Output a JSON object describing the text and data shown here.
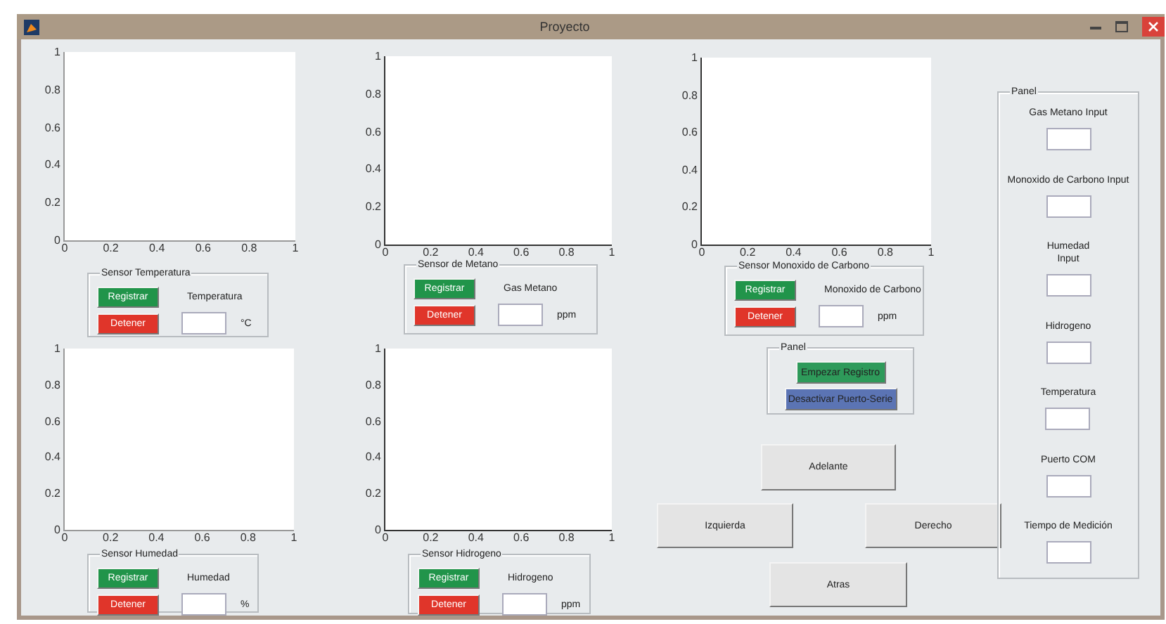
{
  "window": {
    "title": "Proyecto"
  },
  "axes": [
    {
      "y_tick_labels": [
        "1",
        "0.8",
        "0.6",
        "0.4",
        "0.2",
        "0"
      ],
      "x_tick_labels": [
        "0",
        "0.2",
        "0.4",
        "0.6",
        "0.8",
        "1"
      ]
    },
    {
      "y_tick_labels": [
        "1",
        "0.8",
        "0.6",
        "0.4",
        "0.2",
        "0"
      ],
      "x_tick_labels": [
        "0",
        "0.2",
        "0.4",
        "0.6",
        "0.8",
        "1"
      ]
    },
    {
      "y_tick_labels": [
        "1",
        "0.8",
        "0.6",
        "0.4",
        "0.2",
        "0"
      ],
      "x_tick_labels": [
        "0",
        "0.2",
        "0.4",
        "0.6",
        "0.8",
        "1"
      ]
    },
    {
      "y_tick_labels": [
        "1",
        "0.8",
        "0.6",
        "0.4",
        "0.2",
        "0"
      ],
      "x_tick_labels": [
        "0",
        "0.2",
        "0.4",
        "0.6",
        "0.8",
        "1"
      ]
    },
    {
      "y_tick_labels": [
        "1",
        "0.8",
        "0.6",
        "0.4",
        "0.2",
        "0"
      ],
      "x_tick_labels": [
        "0",
        "0.2",
        "0.4",
        "0.6",
        "0.8",
        "1"
      ]
    }
  ],
  "sensor_panels": [
    {
      "title": "Sensor Temperatura",
      "register_button": "Registrar",
      "stop_button": "Detener",
      "label": "Temperatura",
      "unit": "°C"
    },
    {
      "title": "Sensor de Metano",
      "register_button": "Registrar",
      "stop_button": "Detener",
      "label": "Gas Metano",
      "unit": "ppm"
    },
    {
      "title": "Sensor Monoxido de Carbono",
      "register_button": "Registrar",
      "stop_button": "Detener",
      "label": "Monoxido de Carbono",
      "unit": "ppm"
    },
    {
      "title": "Sensor Humedad",
      "register_button": "Registrar",
      "stop_button": "Detener",
      "label": "Humedad",
      "unit": "%"
    },
    {
      "title": "Sensor Hidrogeno",
      "register_button": "Registrar",
      "stop_button": "Detener",
      "label": "Hidrogeno",
      "unit": "ppm"
    }
  ],
  "control_panel": {
    "title": "Panel",
    "buttons": [
      {
        "label": "Empezar Registro",
        "color": "#2e9a5a"
      },
      {
        "label": "Desactivar Puerto-Serie",
        "color": "#5b74b4"
      }
    ]
  },
  "direction_buttons": [
    {
      "label": "Adelante"
    },
    {
      "label": "Izquierda"
    },
    {
      "label": "Derecho"
    },
    {
      "label": "Atras"
    }
  ],
  "input_panel": {
    "title": "Panel",
    "fields": [
      {
        "label": "Gas Metano Input"
      },
      {
        "label": "Monoxido de Carbono Input"
      },
      {
        "label": "Humedad\nInput"
      },
      {
        "label": "Hidrogeno"
      },
      {
        "label": "Temperatura"
      },
      {
        "label": "Puerto COM"
      },
      {
        "label": "Tiempo de Medición"
      }
    ]
  }
}
